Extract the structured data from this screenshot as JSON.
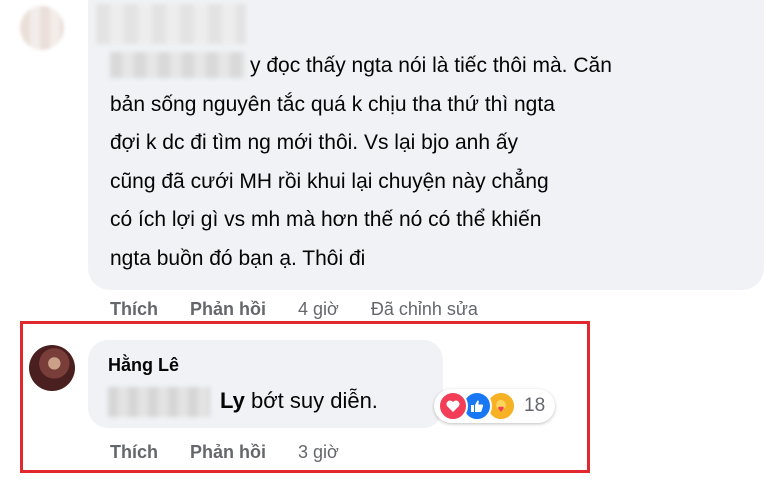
{
  "comment1": {
    "lines": [
      "y đọc thấy ngta nói là tiếc thôi mà. Căn",
      "bản sống nguyên tắc quá k chịu tha thứ thì ngta",
      "đợi k dc đi tìm ng mới thôi. Vs lại bjo anh ấy",
      "cũng đã cưới MH rồi khui lại chuyện này chẳng",
      "có ích lợi gì vs mh mà hơn thế nó có thể khiến",
      "ngta buồn đó bạn ạ. Thôi đi"
    ],
    "actions": {
      "like": "Thích",
      "reply": "Phản hồi",
      "time": "4 giờ",
      "edited": "Đã chỉnh sửa"
    }
  },
  "comment2": {
    "author": "Hằng Lê",
    "tag": "Ly",
    "text": " bớt suy diễn.",
    "reactions": {
      "icons": [
        "love-icon",
        "like-icon",
        "care-icon"
      ],
      "count": "18"
    },
    "actions": {
      "like": "Thích",
      "reply": "Phản hồi",
      "time": "3 giờ"
    }
  },
  "colors": {
    "bubble": "#f0f2f5",
    "highlight_border": "#e0282e",
    "meta_text": "#65676b",
    "love": "#f33e58",
    "like": "#1877f2",
    "care": "#f7b125"
  }
}
